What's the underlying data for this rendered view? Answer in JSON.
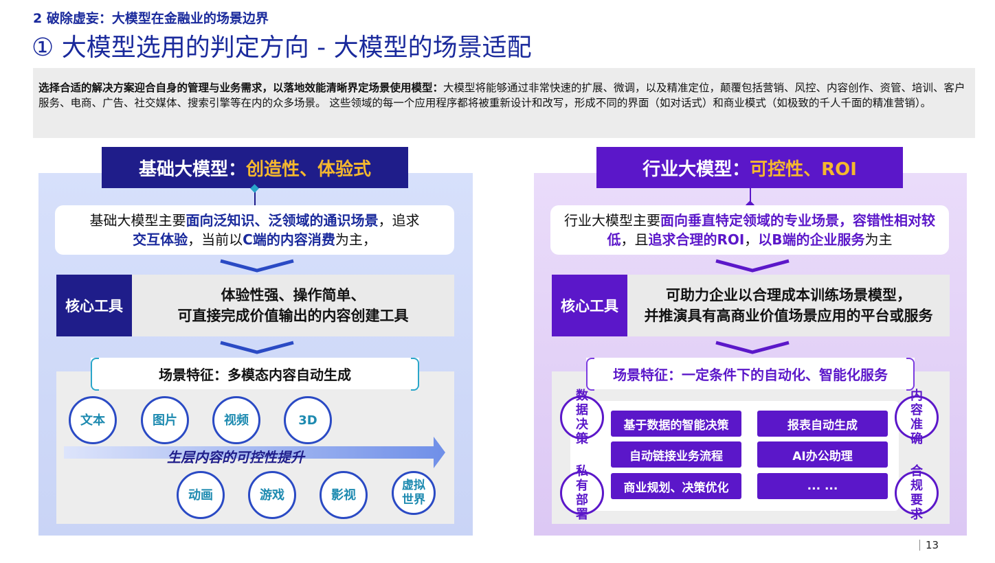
{
  "header": {
    "section_label": "2 破除虚妄：大模型在金融业的场景边界",
    "title": "① 大模型选用的判定方向 - 大模型的场景适配"
  },
  "intro": {
    "lead_bold": "选择合适的解决方案迎合自身的管理与业务需求，以落地效能清晰界定场景使用模型：",
    "body": "大模型将能够通过非常快速的扩展、微调，以及精准定位，颠覆包括营销、风控、内容创作、资管、培训、客户服务、电商、广告、社交媒体、搜索引擎等在内的众多场景。 这些领域的每一个应用程序都将被重新设计和改写，形成不同的界面（如对话式）和商业模式（如极致的千人千面的精准营销）。"
  },
  "left": {
    "title_main": "基础大模型：",
    "title_accent": "创造性、体验式",
    "desc": {
      "p1": "基础大模型主要",
      "h1": "面向泛知识、泛领域的通识场景",
      "p2": "，追求",
      "h2": "交互体验",
      "p3": "，当前以",
      "h3": "C端的内容消费",
      "p4": "为主，"
    },
    "tool_label": "核心工具",
    "tool_line1": "体验性强、操作简单、",
    "tool_line2": "可直接完成价值输出的内容创建工具",
    "feature": "场景特征：多模态内容自动生成",
    "circles_top": [
      "文本",
      "图片",
      "视频",
      "3D"
    ],
    "arrow_text": "生层内容的可控性提升",
    "circles_bottom": [
      "动画",
      "游戏",
      "影视",
      "虚拟世界"
    ]
  },
  "right": {
    "title_main": "行业大模型：",
    "title_accent": "可控性、ROI",
    "desc": {
      "p1": "行业大模型主要",
      "h1": "面向垂直特定领域的专业场景，容错性相对较低",
      "p2": "，且",
      "h2": "追求合理的ROI",
      "p3": "，",
      "h3": "以B端的企业服务",
      "p4": "为主"
    },
    "tool_label": "核心工具",
    "tool_line1": "可助力企业以合理成本训练场景模型，",
    "tool_line2": "并推演具有高商业价值场景应用的平台或服务",
    "feature": "场景特征：一定条件下的自动化、智能化服务",
    "corner_circles": [
      "数据决策",
      "内容准确",
      "私有部署",
      "合规要求"
    ],
    "services": [
      "基于数据的智能决策",
      "报表自动生成",
      "自动链接业务流程",
      "AI办公助理",
      "商业规划、决策优化",
      "... ..."
    ]
  },
  "page_number": "13",
  "colors": {
    "navy": "#1f1d8a",
    "purple": "#5b17c9",
    "accent_orange": "#f5b82e",
    "heading_blue": "#1a2a9c"
  }
}
